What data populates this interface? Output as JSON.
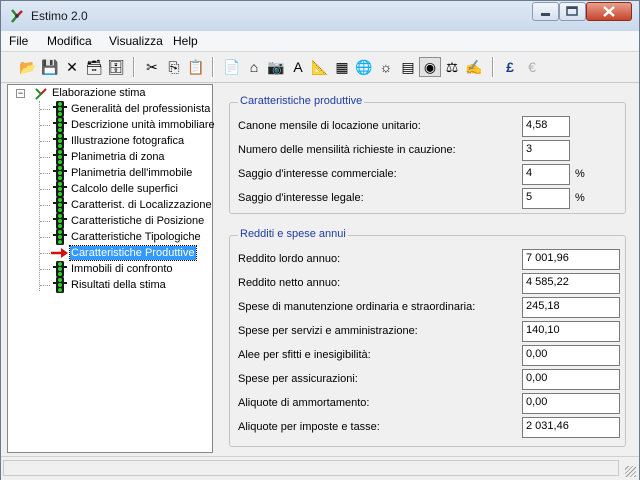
{
  "window": {
    "title": "Estimo 2.0"
  },
  "menu": [
    {
      "label": "File"
    },
    {
      "label": "Modifica"
    },
    {
      "label": "Visualizza"
    },
    {
      "label": "Help"
    }
  ],
  "toolbar": {
    "buttons": [
      {
        "name": "open-folder-icon",
        "glyph": "📂"
      },
      {
        "name": "save-icon",
        "glyph": "💾"
      },
      {
        "name": "delete-icon",
        "glyph": "✕"
      },
      {
        "name": "archive-open-icon",
        "glyph": "🗃"
      },
      {
        "name": "archive-save-icon",
        "glyph": "🗄"
      },
      {
        "name": "cut-icon",
        "glyph": "✂"
      },
      {
        "name": "copy-icon",
        "glyph": "⎘"
      },
      {
        "name": "paste-icon",
        "glyph": "📋"
      },
      {
        "name": "document-icon",
        "glyph": "📄"
      },
      {
        "name": "house-icon",
        "glyph": "⌂"
      },
      {
        "name": "camera-icon",
        "glyph": "📷"
      },
      {
        "name": "compass-icon",
        "glyph": "A"
      },
      {
        "name": "ruler-icon",
        "glyph": "📐"
      },
      {
        "name": "calculator-icon",
        "glyph": "▦"
      },
      {
        "name": "globe-icon",
        "glyph": "🌐"
      },
      {
        "name": "sun-icon",
        "glyph": "☼"
      },
      {
        "name": "grid-icon",
        "glyph": "▤"
      },
      {
        "name": "coins-icon",
        "glyph": "◉"
      },
      {
        "name": "scales-icon",
        "glyph": "⚖"
      },
      {
        "name": "hand-icon",
        "glyph": "✍"
      },
      {
        "name": "pound-icon",
        "glyph": "£"
      },
      {
        "name": "euro-icon",
        "glyph": "€"
      }
    ]
  },
  "tree": {
    "root": "Elaborazione stima",
    "items": [
      {
        "label": "Generalità del professionista"
      },
      {
        "label": "Descrizione unità immobiliare"
      },
      {
        "label": "Illustrazione fotografica"
      },
      {
        "label": "Planimetria di zona"
      },
      {
        "label": "Planimetria dell'immobile"
      },
      {
        "label": "Calcolo delle superfici"
      },
      {
        "label": "Caratterist. di Localizzazione"
      },
      {
        "label": "Caratteristiche di Posizione"
      },
      {
        "label": "Caratteristiche Tipologiche"
      },
      {
        "label": "Caratteristiche Produttive",
        "selected": true
      },
      {
        "label": "Immobili di confronto"
      },
      {
        "label": "Risultati della stima"
      }
    ]
  },
  "caratteristiche": {
    "title": "Caratteristiche produttive",
    "fields": [
      {
        "label": "Canone mensile di locazione unitario:",
        "value": "4,58",
        "unit": ""
      },
      {
        "label": "Numero delle mensilità richieste in cauzione:",
        "value": "3",
        "unit": ""
      },
      {
        "label": "Saggio d'interesse commerciale:",
        "value": "4",
        "unit": "%"
      },
      {
        "label": "Saggio d'interesse legale:",
        "value": "5",
        "unit": "%"
      }
    ]
  },
  "redditi": {
    "title": "Redditi e spese annui",
    "fields": [
      {
        "label": "Reddito lordo annuo:",
        "value": "7 001,96"
      },
      {
        "label": "Reddito netto annuo:",
        "value": "4 585,22"
      },
      {
        "label": "Spese di manutenzione ordinaria e straordinaria:",
        "value": "245,18"
      },
      {
        "label": "Spese per servizi e amministrazione:",
        "value": "140,10"
      },
      {
        "label": "Alee per sfitti e inesigibilità:",
        "value": "0,00"
      },
      {
        "label": "Spese per assicurazioni:",
        "value": "0,00"
      },
      {
        "label": "Aliquote di ammortamento:",
        "value": "0,00"
      },
      {
        "label": "Aliquote per imposte e tasse:",
        "value": "2 031,46"
      }
    ]
  },
  "colors": {
    "group_title": "#1f3ca0",
    "selection": "#3399ff"
  }
}
